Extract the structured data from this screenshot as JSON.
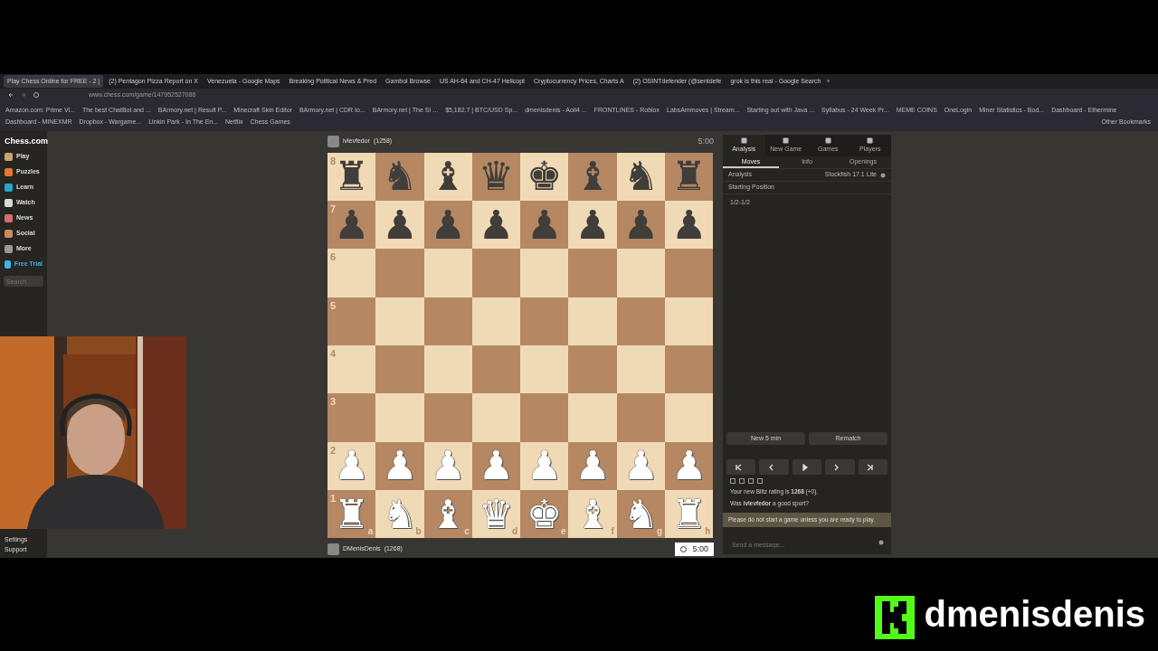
{
  "browser": {
    "tabs": [
      {
        "title": "Play Chess Online for FREE - 2 |",
        "selected": true
      },
      {
        "title": "(2) Pentagon Pizza Report on X",
        "selected": false
      },
      {
        "title": "Venezuela - Google Maps",
        "selected": false
      },
      {
        "title": "Breaking Political News & Pred",
        "selected": false
      },
      {
        "title": "Gambol Browse",
        "selected": false
      },
      {
        "title": "US AH-64 and CH-47 Helicopt",
        "selected": false
      },
      {
        "title": "Cryptocurrency Prices, Charts A",
        "selected": false
      },
      {
        "title": "(2) OSINTdefender (@sentdefe",
        "selected": false
      },
      {
        "title": "grok is this real - Google Search",
        "selected": false
      }
    ],
    "new_tab": "+",
    "url": "www.chess.com/game/147952527086",
    "bookmarks": [
      "Amazon.com: Prime Vi...",
      "The best ChatBot and ...",
      "BArmory.net | Result P...",
      "Minecraft Skin Editor",
      "BArmory.net | CDR Io...",
      "BArmory.net | The SI ...",
      "$5,182.7 | BTC/USD Sp...",
      "dmenisdenis - Aoll4 ...",
      "FRONTLINES - Roblox",
      "LabsAmmoves | Stream...",
      "Starting out with Java ...",
      "Syllabus - 24 Week Pr...",
      "MEME COINS",
      "OneLogin",
      "Miner Statistics - Bod...",
      "Dashboard - Ethermine",
      "Dashboard - MINEXMR",
      "Dropbox - Wargame...",
      "Linkin Park - In The En...",
      "Netflix",
      "Chess Games"
    ],
    "other_bookmarks": "Other Bookmarks"
  },
  "sidebar": {
    "logo": "Chess.com",
    "items": [
      {
        "label": "Play",
        "color": "#c8a46e"
      },
      {
        "label": "Puzzles",
        "color": "#e5772e"
      },
      {
        "label": "Learn",
        "color": "#2ba4c9"
      },
      {
        "label": "Watch",
        "color": "#d8d8d8"
      },
      {
        "label": "News",
        "color": "#d96b6b"
      },
      {
        "label": "Social",
        "color": "#c98a5a"
      },
      {
        "label": "More",
        "color": "#9a9a9a"
      },
      {
        "label": "Free Trial",
        "color": "#3db5e6"
      }
    ],
    "search": {
      "placeholder": "Search"
    },
    "footer": [
      "Settings",
      "Support"
    ]
  },
  "top_player": {
    "name": "ivlevfedor",
    "rating": "(1258)",
    "clock": "5:00"
  },
  "bottom_player": {
    "name": "DMenisDenis",
    "rating": "(1268)",
    "clock": "5:00"
  },
  "board": {
    "ranks": [
      {
        "label": "8",
        "kind": "black",
        "pieces": [
          "♜",
          "♞",
          "♝",
          "♛",
          "♚",
          "♝",
          "♞",
          "♜"
        ]
      },
      {
        "label": "7",
        "kind": "black",
        "pieces": [
          "♟",
          "♟",
          "♟",
          "♟",
          "♟",
          "♟",
          "♟",
          "♟"
        ]
      },
      {
        "label": "6"
      },
      {
        "label": "5"
      },
      {
        "label": "4"
      },
      {
        "label": "3"
      },
      {
        "label": "2",
        "kind": "white",
        "pieces": [
          "♟",
          "♟",
          "♟",
          "♟",
          "♟",
          "♟",
          "♟",
          "♟"
        ]
      },
      {
        "label": "1",
        "kind": "white",
        "pieces": [
          "♜",
          "♞",
          "♝",
          "♛",
          "♚",
          "♝",
          "♞",
          "♜"
        ]
      }
    ],
    "files": [
      "a",
      "b",
      "c",
      "d",
      "e",
      "f",
      "g",
      "h"
    ]
  },
  "panel": {
    "top_tabs": [
      {
        "label": "Analysis",
        "selected": true
      },
      {
        "label": "New Game",
        "selected": false
      },
      {
        "label": "Games",
        "selected": false
      },
      {
        "label": "Players",
        "selected": false
      }
    ],
    "sub_tabs": [
      {
        "label": "Moves",
        "selected": true
      },
      {
        "label": "Info",
        "selected": false
      },
      {
        "label": "Openings",
        "selected": false
      }
    ],
    "analysis": {
      "label": "Analysis",
      "engine": "Stockfish 17.1 Lite"
    },
    "start": "Starting Position",
    "result": "1/2-1/2",
    "actions": [
      "New 5 min",
      "Rematch"
    ],
    "chat": [
      "Your new Blitz rating is **1268** (+0).",
      "Was **ivlevfedor** a good sport?"
    ],
    "notice": "Please do not start a game unless you are ready to play.",
    "message": {
      "placeholder": "Send a message..."
    }
  },
  "overlay": {
    "channel": "dmenisdenis"
  }
}
